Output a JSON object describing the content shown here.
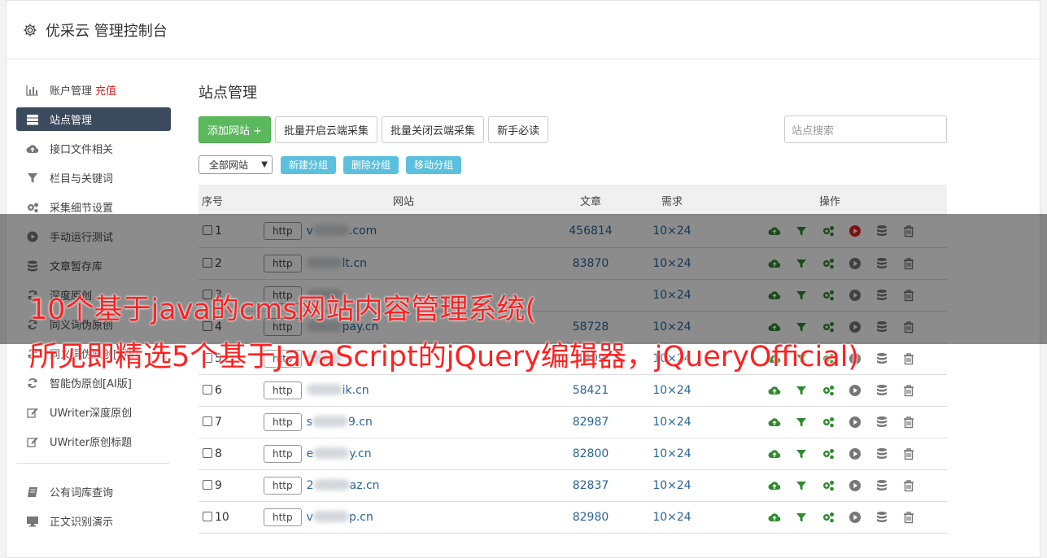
{
  "header": {
    "title": "优采云 管理控制台"
  },
  "sidebar": {
    "items": [
      {
        "label": "账户管理",
        "icon": "bar-chart-icon",
        "extra": "充值"
      },
      {
        "label": "站点管理",
        "icon": "server-icon",
        "active": true
      },
      {
        "label": "接口文件相关",
        "icon": "cloud-upload-icon"
      },
      {
        "label": "栏目与关键词",
        "icon": "filter-icon"
      },
      {
        "label": "采集细节设置",
        "icon": "gears-icon"
      },
      {
        "label": "手动运行测试",
        "icon": "play-icon"
      },
      {
        "label": "文章暂存库",
        "icon": "database-icon"
      },
      {
        "label": "深度原创",
        "icon": "refresh-icon"
      },
      {
        "label": "同义词伪原创",
        "icon": "refresh-icon"
      },
      {
        "label": "同义词伪原创[2版]",
        "icon": "refresh-icon"
      },
      {
        "label": "智能伪原创[AI版]",
        "icon": "refresh-icon"
      },
      {
        "label": "UWriter深度原创",
        "icon": "edit-icon"
      },
      {
        "label": "UWriter原创标题",
        "icon": "edit-icon"
      }
    ],
    "bottom_items": [
      {
        "label": "公有词库查询",
        "icon": "book-icon"
      },
      {
        "label": "正文识别演示",
        "icon": "monitor-icon"
      }
    ]
  },
  "main": {
    "title": "站点管理",
    "toolbar": {
      "add_site": "添加网站 +",
      "batch_open": "批量开启云端采集",
      "batch_close": "批量关闭云端采集",
      "beginner": "新手必读"
    },
    "search_placeholder": "站点搜索",
    "group_select": "全部网站",
    "group_buttons": {
      "new": "新建分组",
      "delete": "删除分组",
      "move": "移动分组"
    },
    "table": {
      "headers": {
        "no": "序号",
        "site": "网站",
        "articles": "文章",
        "need": "需求",
        "ops": "操作"
      },
      "http_label": "http",
      "rows": [
        {
          "no": "1",
          "pre": "v",
          "post": ".com",
          "articles": "456814",
          "need": "10×24",
          "play_active": true
        },
        {
          "no": "2",
          "pre": "",
          "post": "lt.cn",
          "articles": "83870",
          "need": "10×24"
        },
        {
          "no": "3",
          "pre": "",
          "post": "",
          "articles": "",
          "need": "10×24"
        },
        {
          "no": "4",
          "pre": "",
          "post": "pay.cn",
          "articles": "58728",
          "need": "10×24"
        },
        {
          "no": "5",
          "pre": "",
          "post": "",
          "articles": "4909",
          "need": "10×24"
        },
        {
          "no": "6",
          "pre": "",
          "post": "ik.cn",
          "articles": "58421",
          "need": "10×24"
        },
        {
          "no": "7",
          "pre": "s",
          "post": "9.cn",
          "articles": "82987",
          "need": "10×24"
        },
        {
          "no": "8",
          "pre": "e",
          "post": "y.cn",
          "articles": "82800",
          "need": "10×24"
        },
        {
          "no": "9",
          "pre": "2",
          "post": "az.cn",
          "articles": "82837",
          "need": "10×24"
        },
        {
          "no": "10",
          "pre": "v",
          "post": "p.cn",
          "articles": "82980",
          "need": "10×24"
        }
      ]
    }
  },
  "overlay_caption": {
    "line1": "10个基于java的cms网站内容管理系统(",
    "line2": "所见即精选5个基于JavaScript的jQuery编辑器，jQueryOfficial)"
  },
  "colors": {
    "accent_green": "#5cb85c",
    "info_blue": "#5bc0de",
    "active_sidebar": "#3c4a5e",
    "caption_red": "#ff2020"
  }
}
